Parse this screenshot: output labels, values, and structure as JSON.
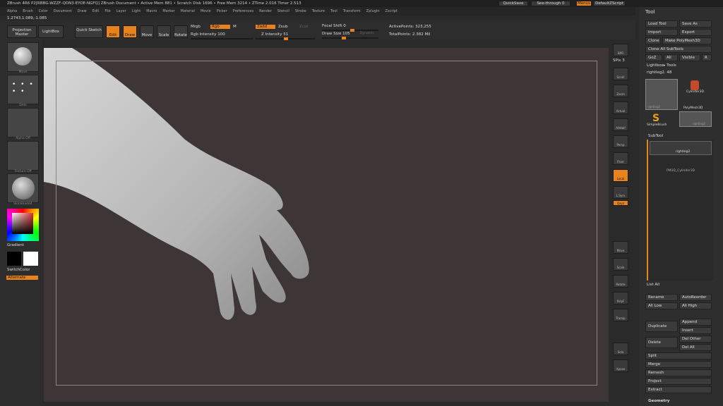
{
  "title_bar": "ZBrush 4R6 P2[RBBG-WZZF-QDN3-EYOE-NGFQ]    ZBrush Document    • Active Mem 881 • Scratch Disk 1696 • Free Mem 3214 • ZTime 2.016 Timer 2.513",
  "quick_save": "QuickSave",
  "see_through": "See-through  0",
  "menus_label": "Menus",
  "default_script": "DefaultZScript",
  "menu_items": [
    "Alpha",
    "Brush",
    "Color",
    "Document",
    "Draw",
    "Edit",
    "File",
    "Layer",
    "Light",
    "Macro",
    "Marker",
    "Material",
    "Movie",
    "Picker",
    "Preferences",
    "Render",
    "Stencil",
    "Stroke",
    "Texture",
    "Tool",
    "Transform",
    "Zplugin",
    "Zscript"
  ],
  "coords": "1.2743,1.089,-1.085",
  "toolbar": {
    "projection_master": "Projection Master",
    "lightbox": "LightBox",
    "quick_sketch": "Quick Sketch",
    "edit": "Edit",
    "draw": "Draw",
    "move": "Move",
    "scale": "Scale",
    "rotate": "Rotate",
    "mrgb": "Mrgb",
    "rgb": "Rgb",
    "m": "M",
    "rgb_intensity": "Rgb Intensity 100",
    "zadd": "Zadd",
    "zsub": "Zsub",
    "zcut": "Zcut",
    "z_intensity": "Z Intensity 51",
    "focal_shift": "Focal Shift 0",
    "draw_size": "Draw Size 105",
    "dynamic": "Dynamic",
    "active_points": "ActivePoints: 323,255",
    "total_points": "TotalPoints: 2.382 Mil"
  },
  "left_shelf": {
    "brush": "Move",
    "stroke": "Dots",
    "alpha": "Alpha Off",
    "texture": "Texture Off",
    "material": "SkinShade4",
    "gradient": "Gradient",
    "switch_color": "SwitchColor",
    "alternate": "Alternate"
  },
  "right_shelf": [
    "BPR",
    "SPix 3",
    "Scroll",
    "Zoom",
    "Actual",
    "AAHalf",
    "Persp",
    "Floor",
    "Local",
    "L.Sym",
    "Qxyz",
    "Move",
    "Scale",
    "Rotate",
    "PolyF",
    "Transp",
    "Solo",
    "Xpose"
  ],
  "panel": {
    "title": "Tool",
    "load_tool": "Load Tool",
    "save_as": "Save As",
    "import": "Import",
    "export": "Export",
    "clone": "Clone",
    "make_polymesh": "Make PolyMesh3D",
    "clone_subtools": "Clone All SubTools",
    "goz": "GoZ",
    "all": "All",
    "visible": "Visible",
    "r": "R",
    "lightbox_tools": "Lightbox▸ Tools",
    "current_tool": "rightleg2. 48",
    "tool_names": [
      "rightleg2",
      "Cylinder3D",
      "PolyMesh3D",
      "SimpleBrush",
      "rightleg2"
    ],
    "subtool_header": "SubTool",
    "subtools": [
      "rightleg2",
      "PM3D_Cylinder3D"
    ],
    "list_all": "List All",
    "rename": "Rename",
    "auto_reorder": "AutoReorder",
    "all_low": "All Low",
    "all_high": "All High",
    "duplicate": "Duplicate",
    "append": "Append",
    "insert": "Insert",
    "delete": "Delete",
    "del_other": "Del Other",
    "del_all": "Del All",
    "split": "Split",
    "merge": "Merge",
    "remesh": "Remesh",
    "project": "Project",
    "extract": "Extract",
    "geometry": "Geometry"
  }
}
